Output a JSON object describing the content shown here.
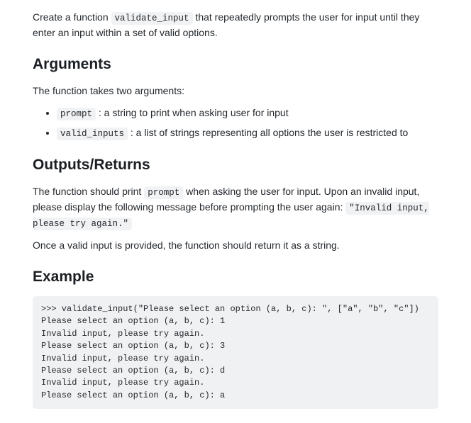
{
  "intro": {
    "before": "Create a function ",
    "fn_name": "validate_input",
    "after": " that repeatedly prompts the user for input until they enter an input within a set of valid options."
  },
  "arguments": {
    "heading": "Arguments",
    "lead": "The function takes two arguments:",
    "items": [
      {
        "code": "prompt",
        "desc": " : a string to print when asking user for input"
      },
      {
        "code": "valid_inputs",
        "desc": " : a list of strings representing all options the user is restricted to"
      }
    ]
  },
  "outputs": {
    "heading": "Outputs/Returns",
    "p1_before": "The function should print ",
    "p1_code": "prompt",
    "p1_mid": " when asking the user for input. Upon an invalid input, please display the following message before prompting the user again: ",
    "p1_code2": "\"Invalid input, please try again.\"",
    "p2": "Once a valid input is provided, the function should return it as a string."
  },
  "example": {
    "heading": "Example",
    "code": ">>> validate_input(\"Please select an option (a, b, c): \", [\"a\", \"b\", \"c\"])\nPlease select an option (a, b, c): 1\nInvalid input, please try again.\nPlease select an option (a, b, c): 3\nInvalid input, please try again.\nPlease select an option (a, b, c): d\nInvalid input, please try again.\nPlease select an option (a, b, c): a"
  }
}
